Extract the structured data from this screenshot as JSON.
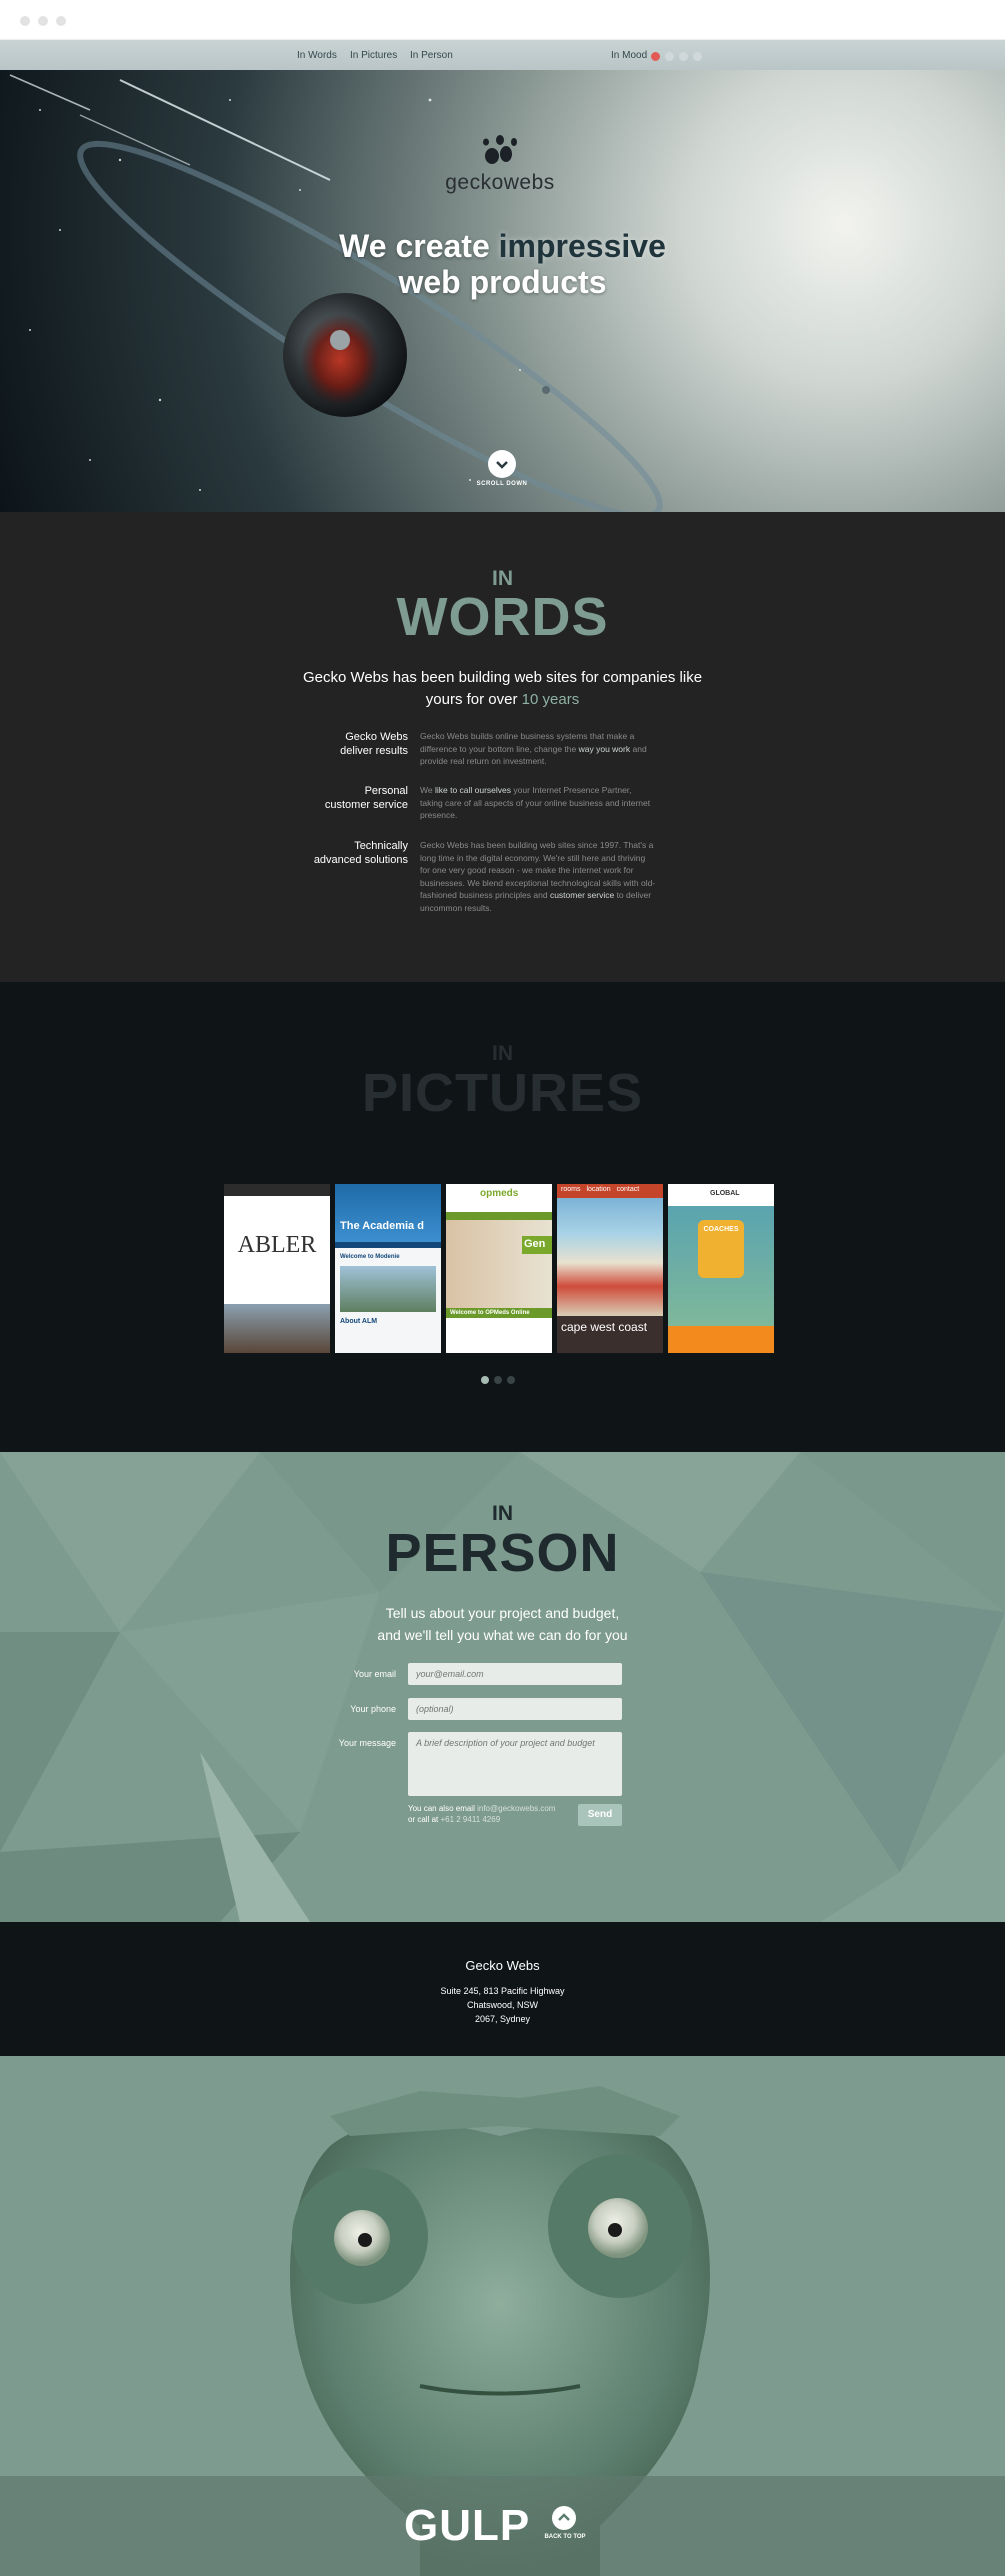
{
  "nav": {
    "items": [
      "In Words",
      "In Pictures",
      "In Person"
    ],
    "mood_label": "In Mood",
    "mood_colors": [
      "#e25c55",
      "#d0d8da",
      "#d0d8da",
      "#d0d8da"
    ]
  },
  "hero": {
    "brand": "geckowebs",
    "headline_white_1": "We create ",
    "headline_dark": "impressive",
    "headline_white_2": "web products",
    "scroll_label": "SCROLL DOWN"
  },
  "words": {
    "small": "IN",
    "big": "WORDS",
    "lead": "Gecko Webs has been building web sites for companies like yours for over ",
    "lead_highlight": "10 years",
    "rows": [
      {
        "label_1": "Gecko Webs",
        "label_2": "deliver results",
        "text_pre": "Gecko Webs builds online business systems that make a difference to your bottom line, change the ",
        "text_hl": "way you work",
        "text_post": " and provide real return on investment."
      },
      {
        "label_1": "Personal",
        "label_2": "customer service",
        "text_pre": "We ",
        "text_hl": "like to call ourselves",
        "text_post": " your Internet Presence Partner, taking care of all aspects of your online business and internet presence."
      },
      {
        "label_1": "Technically",
        "label_2": "advanced solutions",
        "text_pre": "Gecko Webs has been building web sites since 1997. That's a long time in the digital economy. We're still here and thriving for one very good reason - we make the internet work for businesses. We blend exceptional technological skills with old-fashioned business principles and ",
        "text_hl": "customer service",
        "text_post": " to deliver uncommon results."
      }
    ]
  },
  "pictures": {
    "small": "IN",
    "big": "PICTURES",
    "thumbs": [
      {
        "title": "ABLER"
      },
      {
        "title": "The Academia d",
        "sub1": "Welcome to Modenie",
        "sub2": "About ALM"
      },
      {
        "title": "Gen",
        "brand": "opmeds",
        "sub1": "Welcome to OPMeds Online"
      },
      {
        "title": "cape west coast",
        "tabs": [
          "rooms",
          "location",
          "contact"
        ]
      },
      {
        "title": "COACHES",
        "brand": "GLOBAL"
      }
    ]
  },
  "person": {
    "small": "IN",
    "big": "PERSON",
    "lead_1": "Tell us about your project and budget,",
    "lead_2": "and we'll tell you what we can do for you",
    "email_label": "Your email",
    "email_placeholder": "your@email.com",
    "phone_label": "Your phone",
    "phone_placeholder": "(optional)",
    "message_label": "Your message",
    "message_placeholder": "A brief description of your project and budget",
    "also_1": "You can also email ",
    "also_email": "info@geckowebs.com",
    "also_2": "or call at ",
    "also_phone": "+61 2 9411 4269",
    "send": "Send"
  },
  "footer": {
    "name": "Gecko Webs",
    "line1": "Suite 245, 813 Pacific Highway",
    "line2": "Chatswood, NSW",
    "line3": "2067, Sydney"
  },
  "gulp": {
    "text": "GULP",
    "back_to_top": "BACK TO TOP"
  }
}
